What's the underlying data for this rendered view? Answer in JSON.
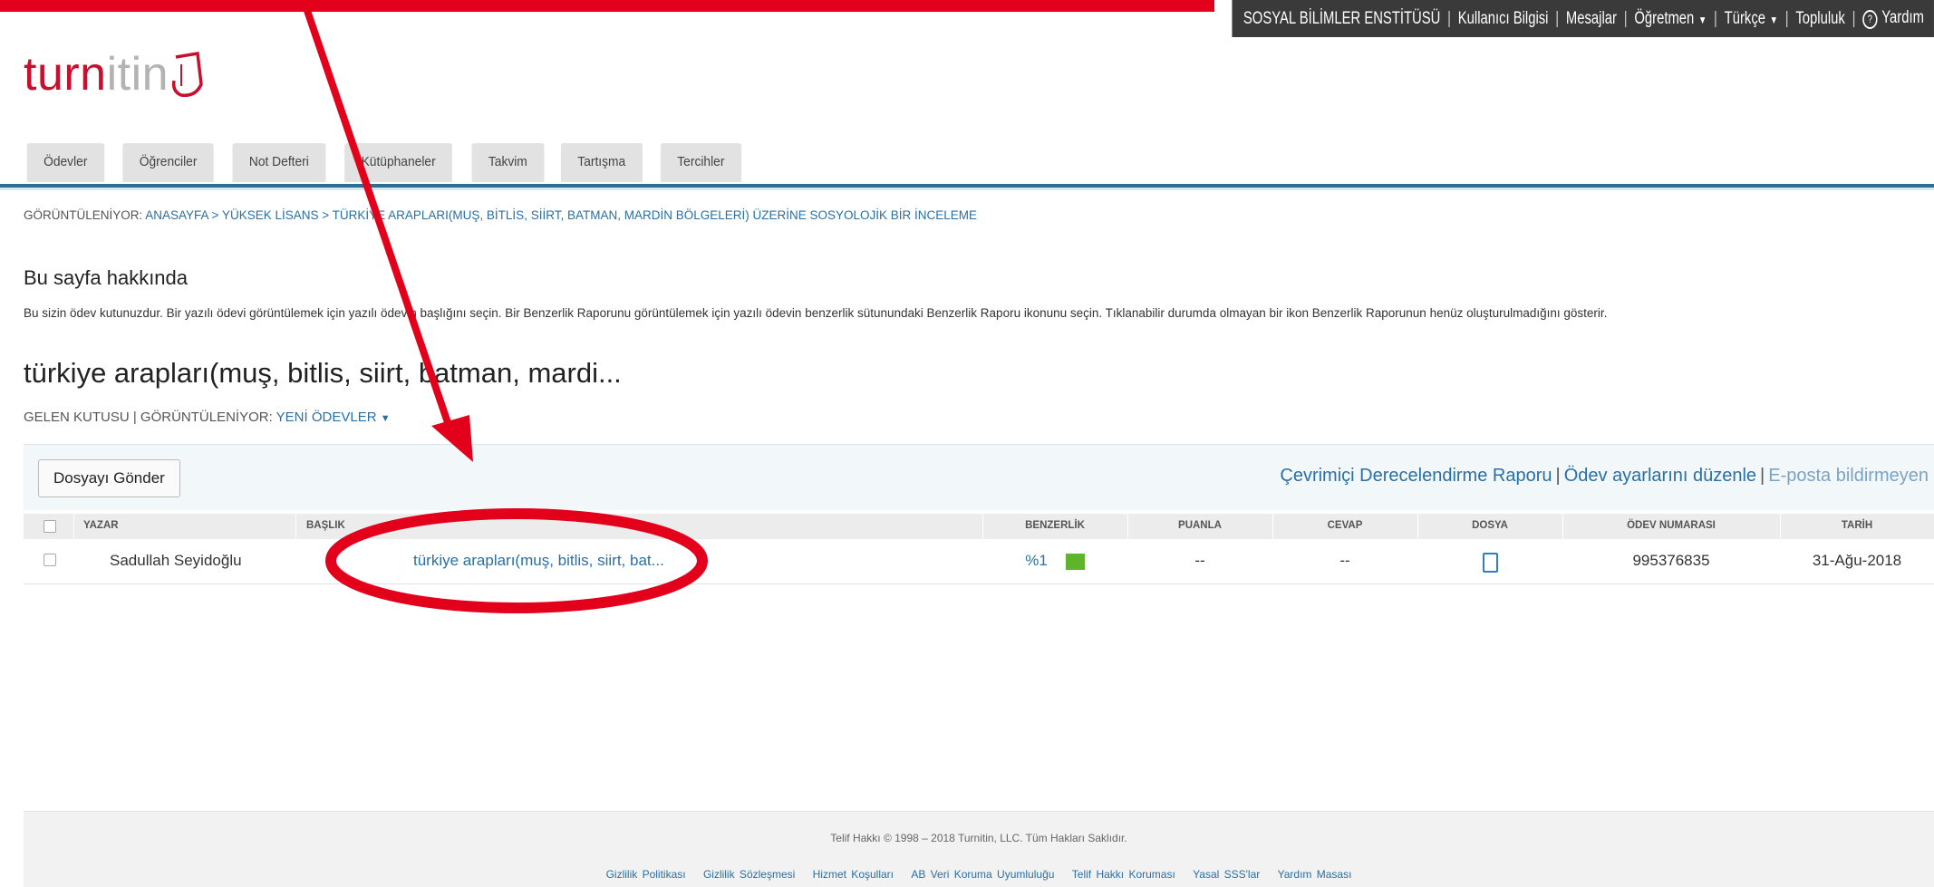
{
  "topnav": {
    "items": [
      "SOSYAL BİLİMLER ENSTİTÜSÜ",
      "Kullanıcı Bilgisi",
      "Mesajlar",
      "Öğretmen",
      "Türkçe",
      "Topluluk",
      "Yardım"
    ]
  },
  "logo": {
    "text_red": "turn",
    "text_gray": "itin"
  },
  "tabs": [
    "Ödevler",
    "Öğrenciler",
    "Not Defteri",
    "Kütüphaneler",
    "Takvim",
    "Tartışma",
    "Tercihler"
  ],
  "breadcrumb": {
    "prefix": "GÖRÜNTÜLENİYOR: ",
    "path": "ANASAYFA > YÜKSEK LİSANS > TÜRKİYE ARAPLARI(MUŞ, BİTLİS, SİİRT, BATMAN, MARDİN BÖLGELERİ) ÜZERİNE SOSYOLOJİK BİR İNCELEME"
  },
  "about": {
    "title": "Bu sayfa hakkında",
    "text": "Bu sizin ödev kutunuzdur. Bir yazılı ödevi görüntülemek için yazılı ödevin başlığını seçin. Bir Benzerlik Raporunu görüntülemek için yazılı ödevin benzerlik sütunundaki Benzerlik Raporu ikonunu seçin. Tıklanabilir durumda olmayan bir ikon Benzerlik Raporunun henüz oluşturulmadığını gösterir."
  },
  "assignment": {
    "title": "türkiye arapları(muş, bitlis, siirt, batman, mardi...",
    "inbox_label": "GELEN KUTUSU | GÖRÜNTÜLENİYOR: ",
    "view_label": "YENİ ÖDEVLER"
  },
  "actions": {
    "submit": "Dosyayı Gönder",
    "grading_report": "Çevrimiçi Derecelendirme Raporu",
    "edit_settings": "Ödev ayarlarını düzenle",
    "email": "E-posta bildirmeyen"
  },
  "table": {
    "headers": [
      "YAZAR",
      "BAŞLIK",
      "BENZERLİK",
      "PUANLA",
      "CEVAP",
      "DOSYA",
      "ÖDEV NUMARASI",
      "TARİH"
    ],
    "row": {
      "author": "Sadullah Seyidoğlu",
      "title": "türkiye arapları(muş, bitlis, siirt, bat...",
      "similarity": "%1",
      "grade": "--",
      "response": "--",
      "paper_id": "995376835",
      "date": "31-Ağu-2018"
    }
  },
  "footer": {
    "copyright": "Telif Hakkı © 1998 – 2018 Turnitin, LLC. Tüm Hakları Saklıdır.",
    "links": [
      "Gizlilik Politikası",
      "Gizlilik Sözleşmesi",
      "Hizmet Koşulları",
      "AB Veri Koruma Uyumluluğu",
      "Telif Hakkı Koruması",
      "Yasal SSS'lar",
      "Yardım Masası"
    ]
  },
  "colors": {
    "brand_red": "#c8102e",
    "link_blue": "#2a6fa5",
    "similarity_green": "#5fb52a",
    "annotation_red": "#e3001b"
  }
}
